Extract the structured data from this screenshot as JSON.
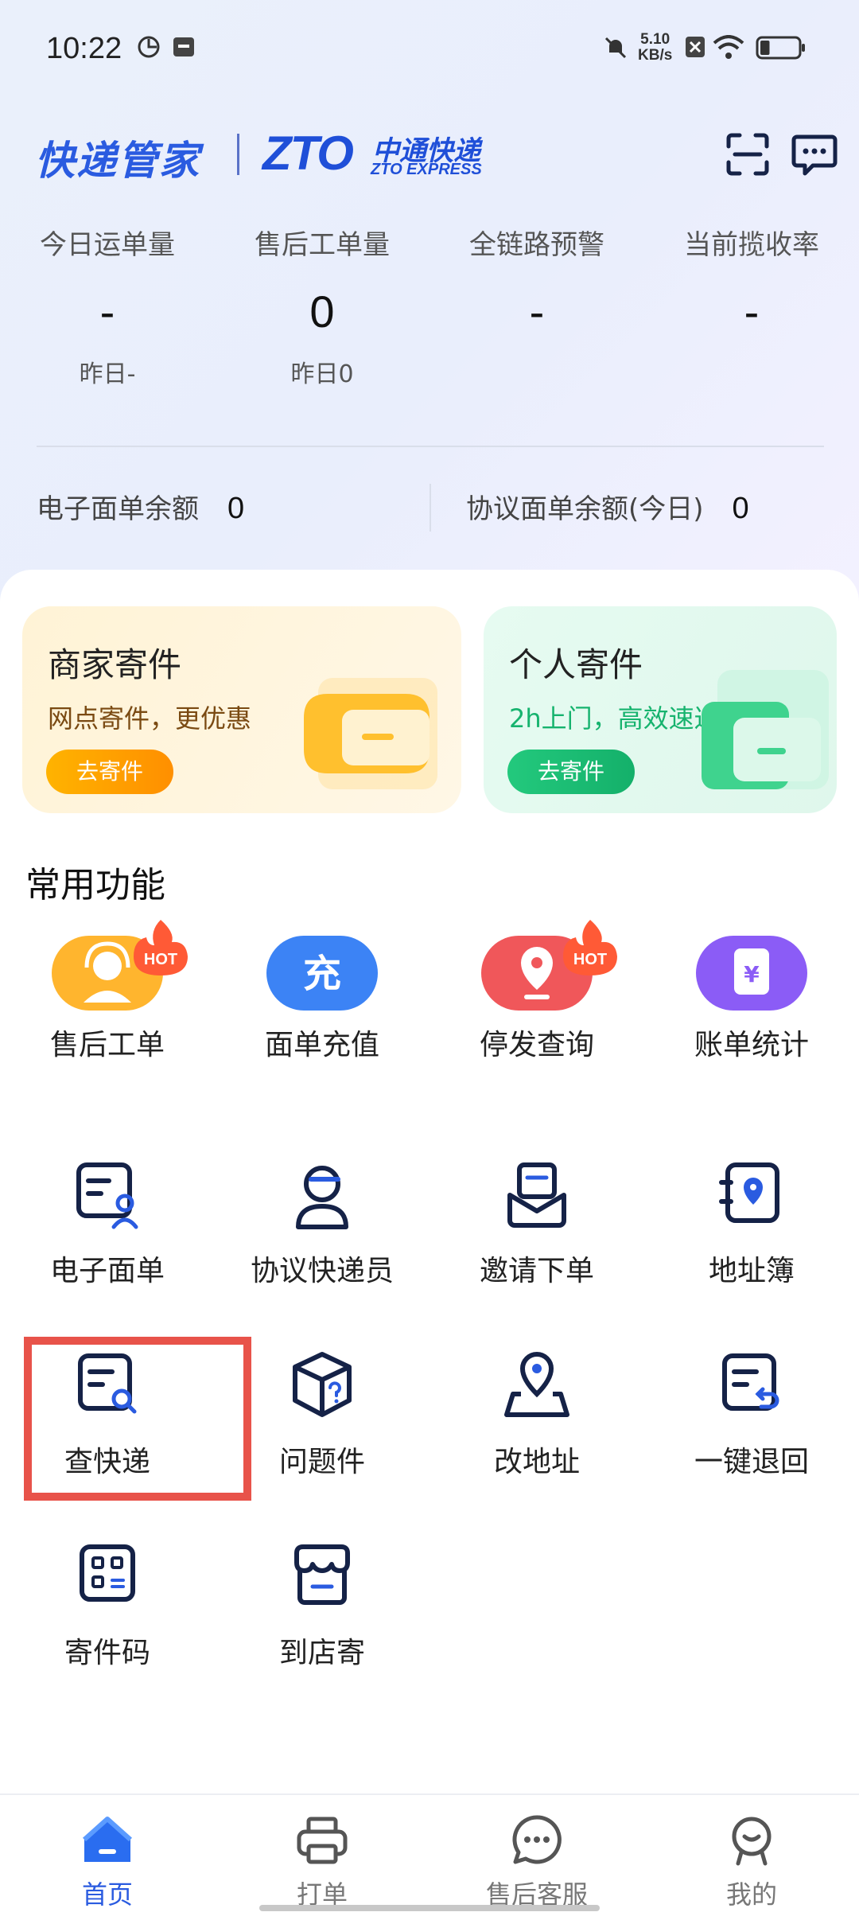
{
  "status_bar": {
    "time": "10:22",
    "net_speed_value": "5.10",
    "net_speed_unit": "KB/s",
    "battery_level": 0.25
  },
  "header": {
    "logo_text": "快递管家",
    "brand_mark": "ZTO",
    "brand_cn": "中通快递",
    "brand_en": "ZTO EXPRESS"
  },
  "stats": [
    {
      "label": "今日运单量",
      "value": "-",
      "sub": "昨日-"
    },
    {
      "label": "售后工单量",
      "value": "0",
      "sub": "昨日0"
    },
    {
      "label": "全链路预警",
      "value": "-",
      "sub": ""
    },
    {
      "label": "当前揽收率",
      "value": "-",
      "sub": ""
    }
  ],
  "balances": {
    "e_waybill_label": "电子面单余额",
    "e_waybill_value": "0",
    "agreement_label": "协议面单余额(今日)",
    "agreement_value": "0"
  },
  "promos": {
    "merchant": {
      "title": "商家寄件",
      "subtitle": "网点寄件，更优惠",
      "button": "去寄件"
    },
    "personal": {
      "title": "个人寄件",
      "subtitle": "2h上门，高效速达",
      "button": "去寄件"
    }
  },
  "common_functions": {
    "title": "常用功能",
    "hot_badge": "HOT",
    "recharge_glyph": "充",
    "bill_glyph": "¥",
    "items": [
      {
        "label": "售后工单",
        "icon": "headset-icon"
      },
      {
        "label": "面单充值",
        "icon": "recharge-icon"
      },
      {
        "label": "停发查询",
        "icon": "location-pin-icon"
      },
      {
        "label": "账单统计",
        "icon": "bill-icon"
      },
      {
        "label": "电子面单",
        "icon": "e-waybill-icon"
      },
      {
        "label": "协议快递员",
        "icon": "courier-icon"
      },
      {
        "label": "邀请下单",
        "icon": "invite-icon"
      },
      {
        "label": "地址簿",
        "icon": "address-book-icon"
      },
      {
        "label": "查快递",
        "icon": "search-document-icon"
      },
      {
        "label": "问题件",
        "icon": "problem-package-icon"
      },
      {
        "label": "改地址",
        "icon": "change-address-icon"
      },
      {
        "label": "一键退回",
        "icon": "return-icon"
      },
      {
        "label": "寄件码",
        "icon": "qr-code-icon"
      },
      {
        "label": "到店寄",
        "icon": "store-icon"
      }
    ]
  },
  "tabs": [
    {
      "label": "首页",
      "active": true
    },
    {
      "label": "打单",
      "active": false
    },
    {
      "label": "售后客服",
      "active": false
    },
    {
      "label": "我的",
      "active": false
    }
  ],
  "colors": {
    "brand_blue": "#2a5be0",
    "highlight_red": "#e8534a",
    "icon_navy": "#152247"
  }
}
